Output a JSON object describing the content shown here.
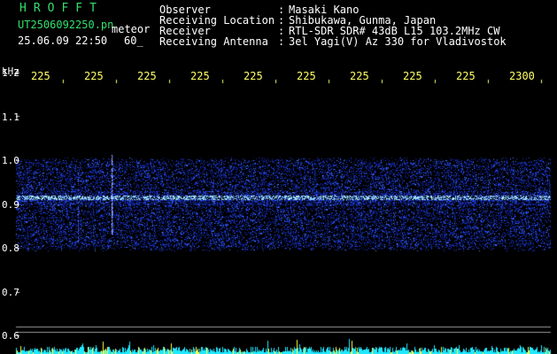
{
  "header": {
    "logo": "HROFFT",
    "filename": "UT2506092250.pn",
    "mode": "meteor",
    "datetime": "25.06.09 22:50",
    "duration": "60_",
    "fields": [
      {
        "label": "Observer",
        "sep": ":",
        "value": "Masaki Kano"
      },
      {
        "label": "Receiving Location",
        "sep": ":",
        "value": "Shibukawa, Gunma, Japan"
      },
      {
        "label": "Receiver",
        "sep": ":",
        "value": "RTL-SDR SDR# 43dB L15 103.2MHz CW"
      },
      {
        "label": "Receiving Antenna",
        "sep": ":",
        "value": "3el Yagi(V) Az 330 for Vladivostok"
      }
    ]
  },
  "chart_data": {
    "type": "heatmap",
    "ylabel": "kHz",
    "ylim": [
      0.58,
      1.28
    ],
    "yticks": [
      "1.2",
      "1.1",
      "1.0",
      "0.9",
      "0.8",
      "0.7",
      "0.6"
    ],
    "ytick_values": [
      1.2,
      1.1,
      1.0,
      0.9,
      0.8,
      0.7,
      0.6
    ],
    "xticks": [
      "225",
      "225",
      "225",
      "225",
      "225",
      "225",
      "225",
      "225",
      "225",
      "2300"
    ],
    "signal": {
      "band_khz": [
        0.8,
        1.0
      ],
      "carrier_khz": 0.915,
      "color_low": "#1a2aff",
      "color_high": "#aaf0ff"
    },
    "colors": {
      "background": "#000000",
      "text": "#ffffff",
      "time_label": "#ffff66",
      "logo": "#33e06a",
      "amplitude_strip": "#20e8ff"
    }
  }
}
